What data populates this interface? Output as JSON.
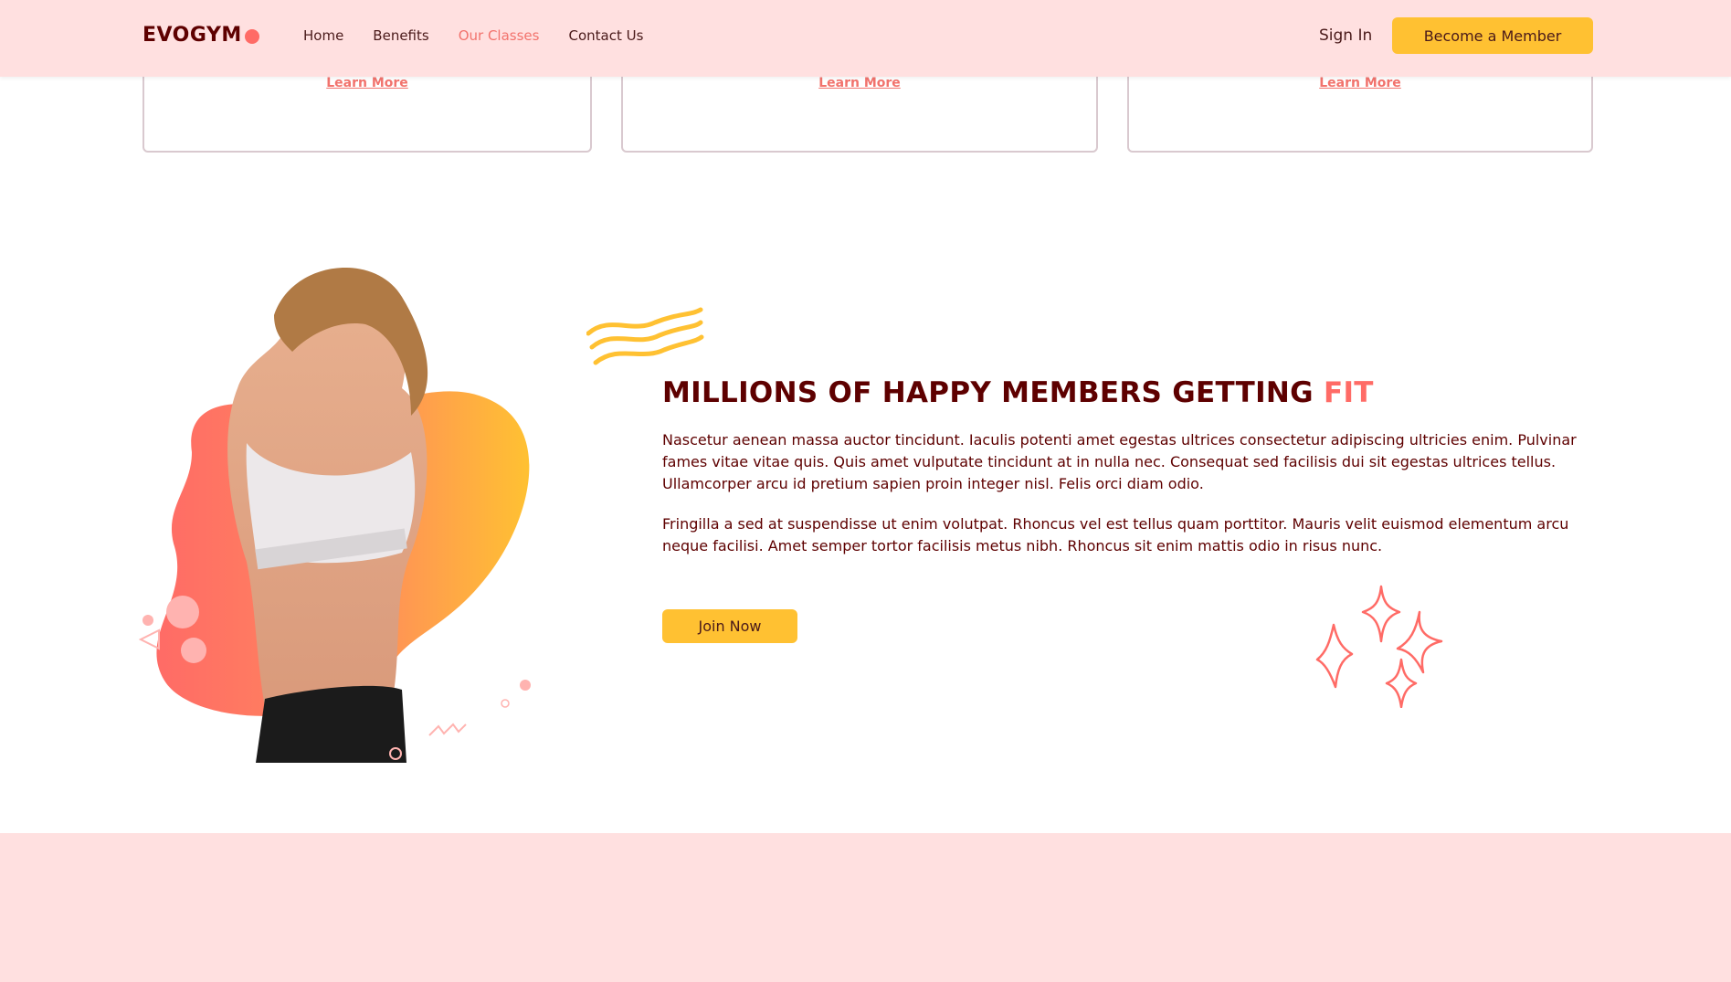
{
  "nav": {
    "logo_text": "EVOGYM",
    "links": [
      "Home",
      "Benefits",
      "Our Classes",
      "Contact Us"
    ],
    "active_link": "Our Classes",
    "sign_in": "Sign In",
    "cta": "Become a Member"
  },
  "cards": [
    {
      "link": "Learn More"
    },
    {
      "link": "Learn More"
    },
    {
      "link": "Learn More"
    }
  ],
  "section": {
    "title_main": "MILLIONS OF HAPPY MEMBERS GETTING",
    "title_accent": "FIT",
    "paragraph_1": "Nascetur aenean massa auctor tincidunt. Iaculis potenti amet egestas ultrices consectetur adipiscing ultricies enim. Pulvinar fames vitae vitae quis. Quis amet vulputate tincidunt at in nulla nec. Consequat sed facilisis dui sit egestas ultrices tellus. Ullamcorper arcu id pretium sapien proin integer nisl. Felis orci diam odio.",
    "paragraph_2": "Fringilla a sed at suspendisse ut enim volutpat. Rhoncus vel est tellus quam porttitor. Mauris velit euismod elementum arcu neque facilisi. Amet semper tortor facilisis metus nibh. Rhoncus sit enim mattis odio in risus nunc.",
    "button": "Join Now"
  },
  "colors": {
    "primary_bg": "#ffe0e0",
    "accent_red": "#ff6b66",
    "accent_yellow": "#ffc132",
    "text_dark": "#5e0000"
  },
  "icons": {
    "hero": "woman-fitness-graphic",
    "waves": "wavy-lines-icon",
    "sparkles": "sparkles-icon"
  }
}
